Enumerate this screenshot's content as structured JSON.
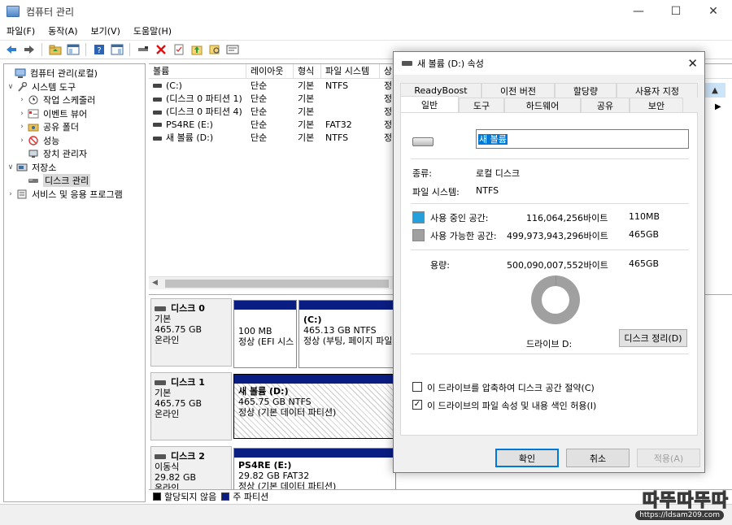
{
  "window": {
    "title": "컴퓨터 관리",
    "minimize": "—",
    "maximize": "☐",
    "close": "✕"
  },
  "menu": [
    "파일(F)",
    "동작(A)",
    "보기(V)",
    "도움말(H)"
  ],
  "toolbar_icons": [
    "back-arrow-icon",
    "forward-arrow-icon",
    "folder-up-icon",
    "show-hide-tree-icon",
    "help-icon",
    "console-icon",
    "connect-icon",
    "delete-icon",
    "properties-icon",
    "up-icon",
    "search-icon",
    "more-icon"
  ],
  "tree": {
    "root": "컴퓨터 관리(로컬)",
    "system_tools": "시스템 도구",
    "task_scheduler": "작업 스케줄러",
    "event_viewer": "이벤트 뷰어",
    "shared_folders": "공유 폴더",
    "performance": "성능",
    "device_manager": "장치 관리자",
    "storage": "저장소",
    "disk_management": "디스크 관리",
    "services": "서비스 및 응용 프로그램"
  },
  "list": {
    "headers": [
      "볼륨",
      "레이아웃",
      "형식",
      "파일 시스템",
      "상"
    ],
    "rows": [
      {
        "volume": "(C:)",
        "layout": "단순",
        "type": "기본",
        "fs": "NTFS",
        "status": "정"
      },
      {
        "volume": "(디스크 0 파티션 1)",
        "layout": "단순",
        "type": "기본",
        "fs": "",
        "status": "정"
      },
      {
        "volume": "(디스크 0 파티션 4)",
        "layout": "단순",
        "type": "기본",
        "fs": "",
        "status": "정"
      },
      {
        "volume": "PS4RE (E:)",
        "layout": "단순",
        "type": "기본",
        "fs": "FAT32",
        "status": "정"
      },
      {
        "volume": "새 볼륨 (D:)",
        "layout": "단순",
        "type": "기본",
        "fs": "NTFS",
        "status": "정"
      }
    ]
  },
  "disks": [
    {
      "name": "디스크 0",
      "kind": "기본",
      "size": "465.75 GB",
      "state": "온라인",
      "parts": [
        {
          "label": "",
          "size": "100 MB",
          "status": "정상 (EFI 시스"
        },
        {
          "label": "(C:)",
          "size": "465.13 GB NTFS",
          "status": "정상 (부팅, 페이지 파일"
        }
      ]
    },
    {
      "name": "디스크 1",
      "kind": "기본",
      "size": "465.75 GB",
      "state": "온라인",
      "parts": [
        {
          "label": "새 볼륨  (D:)",
          "size": "465.75 GB NTFS",
          "status": "정상 (기본 데이터 파티션)"
        }
      ]
    },
    {
      "name": "디스크 2",
      "kind": "이동식",
      "size": "29.82 GB",
      "state": "온라인",
      "parts": [
        {
          "label": "PS4RE  (E:)",
          "size": "29.82 GB FAT32",
          "status": "정상 (기본 데이터 파티션)"
        }
      ]
    }
  ],
  "legend": {
    "unallocated": "할당되지 않음",
    "primary": "주 파티션"
  },
  "watermark": {
    "main": "따뚜따뚜따",
    "url": "https://ldsam209.com"
  },
  "dialog": {
    "title": "새 볼륨 (D:) 속성",
    "tabs_top": [
      "ReadyBoost",
      "이전 버전",
      "할당량",
      "사용자 지정"
    ],
    "tabs_bottom": [
      "일반",
      "도구",
      "하드웨어",
      "공유",
      "보안"
    ],
    "volume_name": "새 볼륨",
    "type_label": "종류:",
    "type_value": "로컬 디스크",
    "fs_label": "파일 시스템:",
    "fs_value": "NTFS",
    "used_label": "사용 중인 공간:",
    "used_bytes": "116,064,256바이트",
    "used_size": "110MB",
    "free_label": "사용 가능한 공간:",
    "free_bytes": "499,973,943,296바이트",
    "free_size": "465GB",
    "capacity_label": "용량:",
    "capacity_bytes": "500,090,007,552바이트",
    "capacity_size": "465GB",
    "drive_label": "드라이브 D:",
    "cleanup_button": "디스크 정리(D)",
    "compress_label": "이 드라이브를 압축하여 디스크 공간 절약(C)",
    "compress_checked": false,
    "index_label": "이 드라이브의 파일 속성 및 내용 색인 허용(I)",
    "index_checked": true,
    "ok": "확인",
    "cancel": "취소",
    "apply": "적용(A)",
    "used_fraction": 0.0002,
    "colors": {
      "used": "#26a0da",
      "free": "#a0a0a0"
    }
  }
}
